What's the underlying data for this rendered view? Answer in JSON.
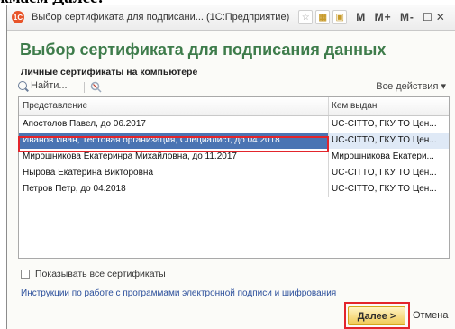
{
  "top_text": "жмаем Далее:",
  "window": {
    "title": "Выбор сертификата для подписани... (1С:Предприятие)",
    "controls": [
      "M",
      "M+",
      "M-"
    ]
  },
  "heading": "Выбор сертификата для подписания данных",
  "subheading": "Личные сертификаты на компьютере",
  "toolbar": {
    "find_label": "Найти...",
    "all_actions_label": "Все действия ▾"
  },
  "table": {
    "columns": [
      "Представление",
      "Кем выдан"
    ],
    "rows": [
      {
        "name": "Апостолов Павел, до 06.2017",
        "issuer": "UC-CITTO, ГКУ ТО Цен..."
      },
      {
        "name": "Иванов Иван, Тестовая организация, Специалист, до 04.2018",
        "issuer": "UC-CITTO, ГКУ ТО Цен..."
      },
      {
        "name": "Мирошникова Екатеринра Михайловна, до 11.2017",
        "issuer": "Мирошникова Екатери..."
      },
      {
        "name": "Нырова Екатерина Викторовна",
        "issuer": "UC-CITTO, ГКУ ТО Цен..."
      },
      {
        "name": "Петров Петр, до 04.2018",
        "issuer": "UC-CITTO, ГКУ ТО Цен..."
      }
    ],
    "selected_index": 1
  },
  "show_all_label": "Показывать все сертификаты",
  "instructions_link": "Инструкции по работе с программами электронной подписи и шифрования",
  "next_label": "Далее >",
  "cancel_label": "Отмена",
  "colors": {
    "heading": "#3e7c4b",
    "selection": "#4a74b3",
    "highlight": "#e3252c",
    "primary_button": "#f0c955"
  }
}
